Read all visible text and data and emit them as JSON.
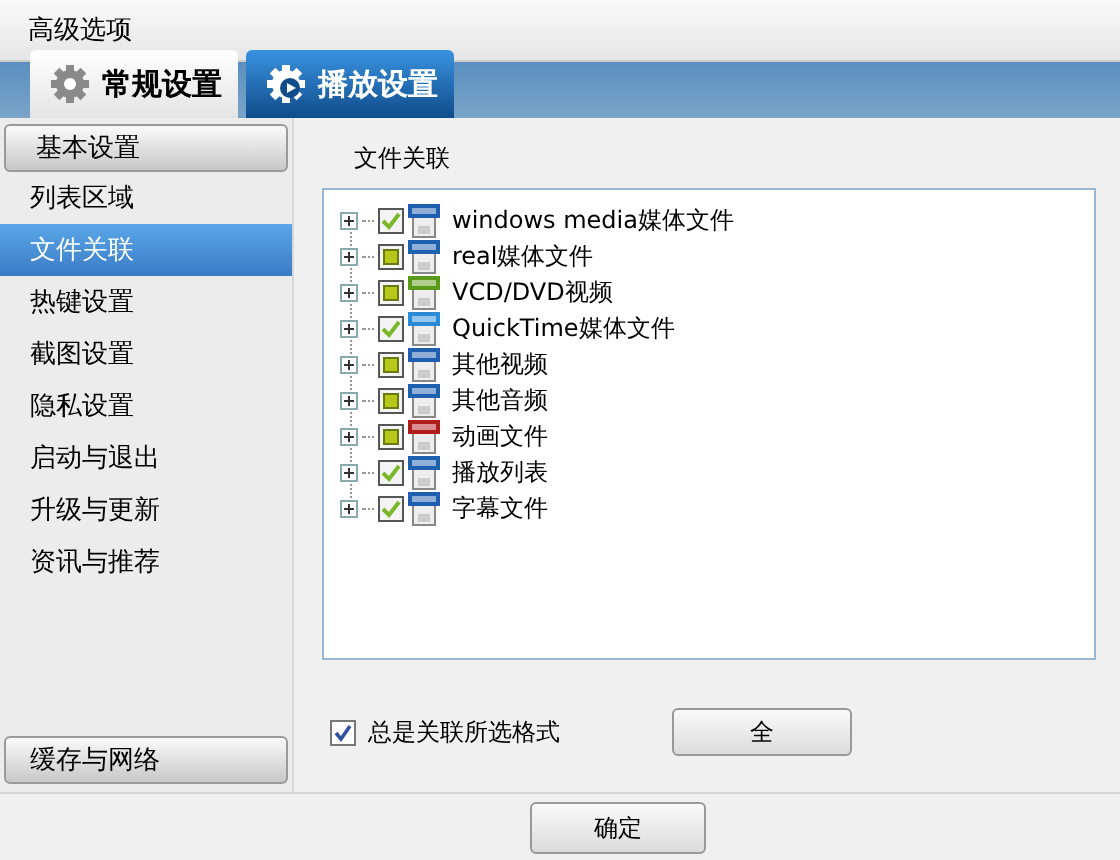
{
  "window": {
    "title": "高级选项"
  },
  "tabs": [
    {
      "label": "常规设置",
      "selected": true
    },
    {
      "label": "播放设置",
      "selected": false
    }
  ],
  "sidebar": {
    "items": [
      {
        "label": "基本设置",
        "kind": "header",
        "selected": false
      },
      {
        "label": "列表区域",
        "kind": "item",
        "selected": false
      },
      {
        "label": "文件关联",
        "kind": "item",
        "selected": true
      },
      {
        "label": "热键设置",
        "kind": "item",
        "selected": false
      },
      {
        "label": "截图设置",
        "kind": "item",
        "selected": false
      },
      {
        "label": "隐私设置",
        "kind": "item",
        "selected": false
      },
      {
        "label": "启动与退出",
        "kind": "item",
        "selected": false
      },
      {
        "label": "升级与更新",
        "kind": "item",
        "selected": false
      },
      {
        "label": "资讯与推荐",
        "kind": "item",
        "selected": false
      }
    ],
    "bottom_item": {
      "label": "缓存与网络"
    }
  },
  "group": {
    "title": "文件关联",
    "tree": [
      {
        "label": "windows media媒体文件",
        "checked": true,
        "expanded": false,
        "color": "#1f5fb0"
      },
      {
        "label": "real媒体文件",
        "checked": false,
        "expanded": false,
        "color": "#1f5fb0"
      },
      {
        "label": "VCD/DVD视频",
        "checked": false,
        "expanded": false,
        "color": "#5a9a1a"
      },
      {
        "label": "QuickTime媒体文件",
        "checked": true,
        "expanded": false,
        "color": "#2a8ad8"
      },
      {
        "label": "其他视频",
        "checked": false,
        "expanded": false,
        "color": "#1f5fb0"
      },
      {
        "label": "其他音频",
        "checked": false,
        "expanded": false,
        "color": "#1f5fb0"
      },
      {
        "label": "动画文件",
        "checked": false,
        "expanded": false,
        "color": "#b01c1c"
      },
      {
        "label": "播放列表",
        "checked": true,
        "expanded": false,
        "color": "#1f5fb0"
      },
      {
        "label": "字幕文件",
        "checked": true,
        "expanded": false,
        "color": "#1f5fb0"
      }
    ]
  },
  "always_associate": {
    "label": "总是关联所选格式",
    "checked": true
  },
  "select_button": {
    "label": "全"
  },
  "ok_button": {
    "label": "确定"
  }
}
